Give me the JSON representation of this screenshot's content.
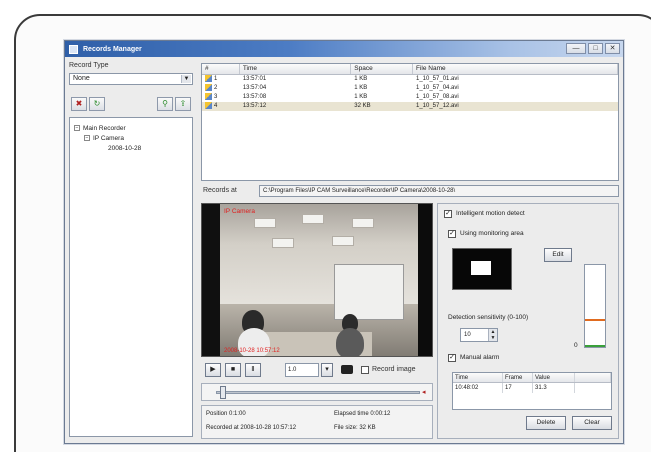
{
  "window": {
    "title": "Records Manager",
    "buttons": [
      "—",
      "□",
      "✕"
    ]
  },
  "left_panel": {
    "record_type_label": "Record Type",
    "record_type_value": "None",
    "tree": [
      {
        "label": "Main Recorder",
        "level": 1,
        "expander": "−"
      },
      {
        "label": "IP Camera",
        "level": 2,
        "expander": "−"
      },
      {
        "label": "2008-10-28",
        "level": 3,
        "expander": ""
      }
    ]
  },
  "file_list": {
    "columns": [
      "#",
      "Time",
      "Space",
      "File Name"
    ],
    "rows": [
      {
        "idx": "1",
        "time": "13:57:01",
        "space": "1 KB",
        "file": "1_10_57_01.avi",
        "selected": false
      },
      {
        "idx": "2",
        "time": "13:57:04",
        "space": "1 KB",
        "file": "1_10_57_04.avi",
        "selected": false
      },
      {
        "idx": "3",
        "time": "13:57:08",
        "space": "1 KB",
        "file": "1_10_57_08.avi",
        "selected": false
      },
      {
        "idx": "4",
        "time": "13:57:12",
        "space": "32 KB",
        "file": "1_10_57_12.avi",
        "selected": true
      }
    ]
  },
  "path_bar": {
    "label": "Records at",
    "path": "C:\\Program Files\\IP CAM Surveillance\\Recorder\\IP Camera\\2008-10-28\\"
  },
  "video": {
    "osd_title": "IP Camera",
    "osd_time": "2008-10-28 10:57:12"
  },
  "controls": {
    "play": "▶",
    "stop": "■",
    "pause": "Ⅱ",
    "speed_value": "1.0",
    "speed_arrow": "▾",
    "record_image_label": "Record image",
    "slider_end": "◂"
  },
  "status": {
    "position_label": "Position 0:1:00",
    "recorded_at": "Recorded at 2008-10-28 10:57:12",
    "elapsed_label": "Elapsed time 0:00:12",
    "file_size_label": "File size: 32 KB"
  },
  "settings": {
    "motion_detect_label": "Intelligent motion detect",
    "monitoring_area_label": "Using monitoring area",
    "edit_button": "Edit",
    "sensitivity_label": "Detection sensitivity (0-100)",
    "sensitivity_value": "10",
    "meter_zero": "0",
    "manual_alarm_label": "Manual alarm",
    "alarm_columns": [
      "Time",
      "Frame",
      "Value",
      ""
    ],
    "alarm_rows": [
      {
        "time": "10:48:02",
        "frame": "17",
        "value": "31.3"
      }
    ],
    "delete_button": "Delete",
    "clear_button": "Clear"
  },
  "colors": {
    "title_bar": "#2f5fa8",
    "osd_red": "#e02020",
    "meter_orange": "#e06b1f",
    "meter_green": "#3aa03a"
  }
}
